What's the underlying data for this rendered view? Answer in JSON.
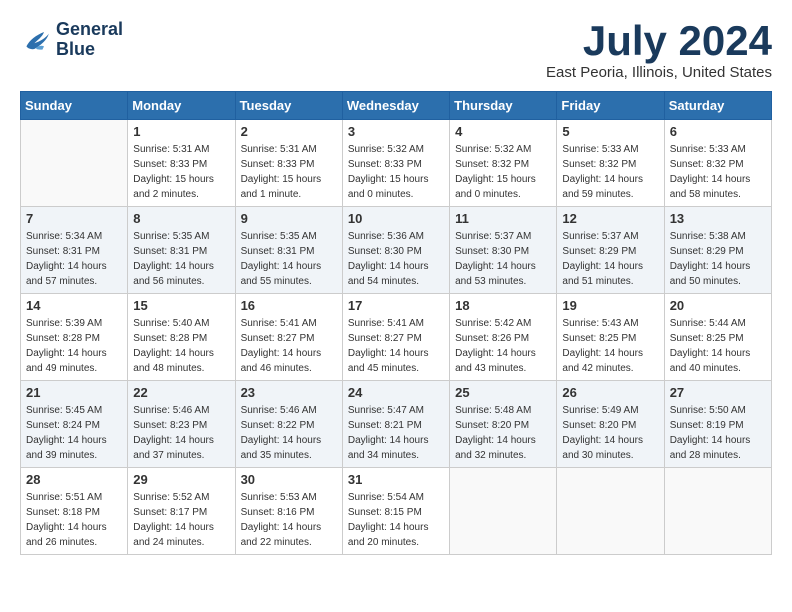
{
  "header": {
    "logo_line1": "General",
    "logo_line2": "Blue",
    "month": "July 2024",
    "location": "East Peoria, Illinois, United States"
  },
  "days_of_week": [
    "Sunday",
    "Monday",
    "Tuesday",
    "Wednesday",
    "Thursday",
    "Friday",
    "Saturday"
  ],
  "weeks": [
    [
      {
        "day": "",
        "sunrise": "",
        "sunset": "",
        "daylight": ""
      },
      {
        "day": "1",
        "sunrise": "Sunrise: 5:31 AM",
        "sunset": "Sunset: 8:33 PM",
        "daylight": "Daylight: 15 hours and 2 minutes."
      },
      {
        "day": "2",
        "sunrise": "Sunrise: 5:31 AM",
        "sunset": "Sunset: 8:33 PM",
        "daylight": "Daylight: 15 hours and 1 minute."
      },
      {
        "day": "3",
        "sunrise": "Sunrise: 5:32 AM",
        "sunset": "Sunset: 8:33 PM",
        "daylight": "Daylight: 15 hours and 0 minutes."
      },
      {
        "day": "4",
        "sunrise": "Sunrise: 5:32 AM",
        "sunset": "Sunset: 8:32 PM",
        "daylight": "Daylight: 15 hours and 0 minutes."
      },
      {
        "day": "5",
        "sunrise": "Sunrise: 5:33 AM",
        "sunset": "Sunset: 8:32 PM",
        "daylight": "Daylight: 14 hours and 59 minutes."
      },
      {
        "day": "6",
        "sunrise": "Sunrise: 5:33 AM",
        "sunset": "Sunset: 8:32 PM",
        "daylight": "Daylight: 14 hours and 58 minutes."
      }
    ],
    [
      {
        "day": "7",
        "sunrise": "Sunrise: 5:34 AM",
        "sunset": "Sunset: 8:31 PM",
        "daylight": "Daylight: 14 hours and 57 minutes."
      },
      {
        "day": "8",
        "sunrise": "Sunrise: 5:35 AM",
        "sunset": "Sunset: 8:31 PM",
        "daylight": "Daylight: 14 hours and 56 minutes."
      },
      {
        "day": "9",
        "sunrise": "Sunrise: 5:35 AM",
        "sunset": "Sunset: 8:31 PM",
        "daylight": "Daylight: 14 hours and 55 minutes."
      },
      {
        "day": "10",
        "sunrise": "Sunrise: 5:36 AM",
        "sunset": "Sunset: 8:30 PM",
        "daylight": "Daylight: 14 hours and 54 minutes."
      },
      {
        "day": "11",
        "sunrise": "Sunrise: 5:37 AM",
        "sunset": "Sunset: 8:30 PM",
        "daylight": "Daylight: 14 hours and 53 minutes."
      },
      {
        "day": "12",
        "sunrise": "Sunrise: 5:37 AM",
        "sunset": "Sunset: 8:29 PM",
        "daylight": "Daylight: 14 hours and 51 minutes."
      },
      {
        "day": "13",
        "sunrise": "Sunrise: 5:38 AM",
        "sunset": "Sunset: 8:29 PM",
        "daylight": "Daylight: 14 hours and 50 minutes."
      }
    ],
    [
      {
        "day": "14",
        "sunrise": "Sunrise: 5:39 AM",
        "sunset": "Sunset: 8:28 PM",
        "daylight": "Daylight: 14 hours and 49 minutes."
      },
      {
        "day": "15",
        "sunrise": "Sunrise: 5:40 AM",
        "sunset": "Sunset: 8:28 PM",
        "daylight": "Daylight: 14 hours and 48 minutes."
      },
      {
        "day": "16",
        "sunrise": "Sunrise: 5:41 AM",
        "sunset": "Sunset: 8:27 PM",
        "daylight": "Daylight: 14 hours and 46 minutes."
      },
      {
        "day": "17",
        "sunrise": "Sunrise: 5:41 AM",
        "sunset": "Sunset: 8:27 PM",
        "daylight": "Daylight: 14 hours and 45 minutes."
      },
      {
        "day": "18",
        "sunrise": "Sunrise: 5:42 AM",
        "sunset": "Sunset: 8:26 PM",
        "daylight": "Daylight: 14 hours and 43 minutes."
      },
      {
        "day": "19",
        "sunrise": "Sunrise: 5:43 AM",
        "sunset": "Sunset: 8:25 PM",
        "daylight": "Daylight: 14 hours and 42 minutes."
      },
      {
        "day": "20",
        "sunrise": "Sunrise: 5:44 AM",
        "sunset": "Sunset: 8:25 PM",
        "daylight": "Daylight: 14 hours and 40 minutes."
      }
    ],
    [
      {
        "day": "21",
        "sunrise": "Sunrise: 5:45 AM",
        "sunset": "Sunset: 8:24 PM",
        "daylight": "Daylight: 14 hours and 39 minutes."
      },
      {
        "day": "22",
        "sunrise": "Sunrise: 5:46 AM",
        "sunset": "Sunset: 8:23 PM",
        "daylight": "Daylight: 14 hours and 37 minutes."
      },
      {
        "day": "23",
        "sunrise": "Sunrise: 5:46 AM",
        "sunset": "Sunset: 8:22 PM",
        "daylight": "Daylight: 14 hours and 35 minutes."
      },
      {
        "day": "24",
        "sunrise": "Sunrise: 5:47 AM",
        "sunset": "Sunset: 8:21 PM",
        "daylight": "Daylight: 14 hours and 34 minutes."
      },
      {
        "day": "25",
        "sunrise": "Sunrise: 5:48 AM",
        "sunset": "Sunset: 8:20 PM",
        "daylight": "Daylight: 14 hours and 32 minutes."
      },
      {
        "day": "26",
        "sunrise": "Sunrise: 5:49 AM",
        "sunset": "Sunset: 8:20 PM",
        "daylight": "Daylight: 14 hours and 30 minutes."
      },
      {
        "day": "27",
        "sunrise": "Sunrise: 5:50 AM",
        "sunset": "Sunset: 8:19 PM",
        "daylight": "Daylight: 14 hours and 28 minutes."
      }
    ],
    [
      {
        "day": "28",
        "sunrise": "Sunrise: 5:51 AM",
        "sunset": "Sunset: 8:18 PM",
        "daylight": "Daylight: 14 hours and 26 minutes."
      },
      {
        "day": "29",
        "sunrise": "Sunrise: 5:52 AM",
        "sunset": "Sunset: 8:17 PM",
        "daylight": "Daylight: 14 hours and 24 minutes."
      },
      {
        "day": "30",
        "sunrise": "Sunrise: 5:53 AM",
        "sunset": "Sunset: 8:16 PM",
        "daylight": "Daylight: 14 hours and 22 minutes."
      },
      {
        "day": "31",
        "sunrise": "Sunrise: 5:54 AM",
        "sunset": "Sunset: 8:15 PM",
        "daylight": "Daylight: 14 hours and 20 minutes."
      },
      {
        "day": "",
        "sunrise": "",
        "sunset": "",
        "daylight": ""
      },
      {
        "day": "",
        "sunrise": "",
        "sunset": "",
        "daylight": ""
      },
      {
        "day": "",
        "sunrise": "",
        "sunset": "",
        "daylight": ""
      }
    ]
  ]
}
